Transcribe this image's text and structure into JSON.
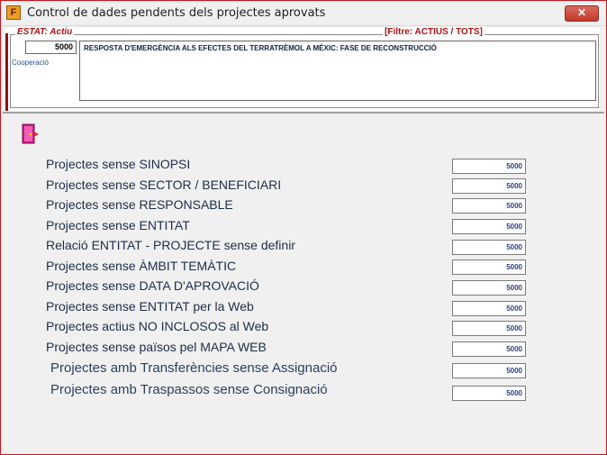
{
  "window": {
    "title": "Control de dades pendents dels projectes aprovats",
    "app_icon": "F",
    "close_glyph": "✕"
  },
  "project": {
    "estat_label": "ESTAT: Actiu",
    "filter_label": "[Filtre: ACTIUS / TOTS]",
    "code": "5000",
    "description": "RESPOSTA D'EMERGÈNCIA ALS EFECTES DEL TERRATRÈMOL A MÈXIC: FASE DE RECONSTRUCCIÓ",
    "area": "Cooperació"
  },
  "toolbar": {
    "exit_icon": "exit-door-icon"
  },
  "checks": [
    {
      "label": "Projectes sense SINOPSI",
      "count": "5000"
    },
    {
      "label": "Projectes sense SECTOR / BENEFICIARI",
      "count": "5000"
    },
    {
      "label": "Projectes sense RESPONSABLE",
      "count": "5000"
    },
    {
      "label": "Projectes sense ENTITAT",
      "count": "5000"
    },
    {
      "label": "Relació ENTITAT - PROJECTE sense definir",
      "count": "5000"
    },
    {
      "label": "Projectes sense ÀMBIT TEMÀTIC",
      "count": "5000"
    },
    {
      "label": "Projectes sense DATA D'APROVACIÓ",
      "count": "5000"
    },
    {
      "label": "Projectes sense ENTITAT per la Web",
      "count": "5000"
    },
    {
      "label": "Projectes actius NO INCLOSOS al Web",
      "count": "5000"
    },
    {
      "label": "Projectes sense països pel MAPA WEB",
      "count": "5000"
    },
    {
      "label": "Projectes amb Transferències sense Assignació",
      "count": "5000"
    },
    {
      "label": "Projectes amb Traspassos sense Consignació",
      "count": "5000"
    }
  ],
  "colors": {
    "accent_red": "#b01010",
    "close_red": "#c0392b",
    "label_navy": "#1a2e4a"
  }
}
